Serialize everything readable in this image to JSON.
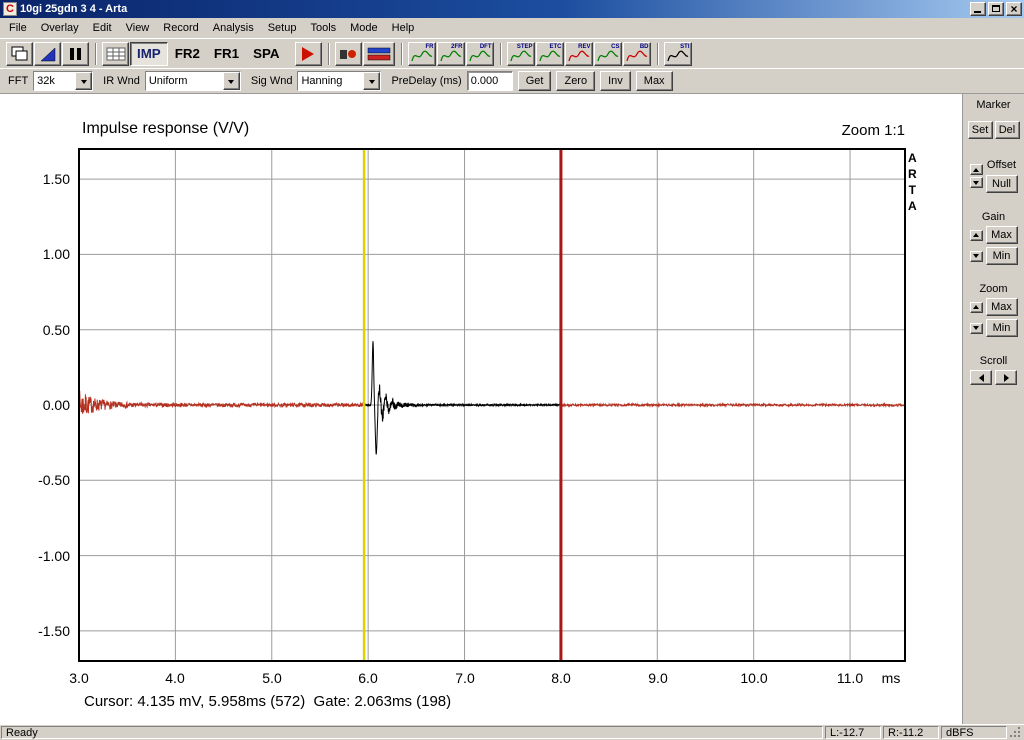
{
  "titlebar": {
    "title": "10gi 25gdn 3 4 - Arta",
    "app_icon_letter": "C"
  },
  "menu": {
    "items": [
      "File",
      "Overlay",
      "Edit",
      "View",
      "Record",
      "Analysis",
      "Setup",
      "Tools",
      "Mode",
      "Help"
    ]
  },
  "toolbar1": {
    "mode_buttons": [
      {
        "label": "IMP",
        "active": true
      },
      {
        "label": "FR2",
        "active": false
      },
      {
        "label": "FR1",
        "active": false
      },
      {
        "label": "SPA",
        "active": false
      }
    ],
    "analysis_icons": [
      {
        "id": "fr",
        "label": "FR",
        "color": "#008000",
        "sep_before": false
      },
      {
        "id": "fr2",
        "label": "2FR",
        "color": "#008000",
        "sep_before": false
      },
      {
        "id": "dft",
        "label": "DFT",
        "color": "#008000",
        "sep_before": false
      },
      {
        "id": "step",
        "label": "STEP",
        "color": "#008000",
        "sep_before": true
      },
      {
        "id": "etc",
        "label": "ETC",
        "color": "#008000",
        "sep_before": false
      },
      {
        "id": "rev",
        "label": "REV",
        "color": "#cc0000",
        "sep_before": false
      },
      {
        "id": "cs",
        "label": "CS",
        "color": "#008000",
        "sep_before": false
      },
      {
        "id": "bd",
        "label": "BD",
        "color": "#cc0000",
        "sep_before": false
      },
      {
        "id": "sti",
        "label": "STI",
        "color": "#000000",
        "sep_before": true
      }
    ]
  },
  "controlbar": {
    "fft_label": "FFT",
    "fft_value": "32k",
    "ir_wnd_label": "IR Wnd",
    "ir_wnd_value": "Uniform",
    "sig_wnd_label": "Sig Wnd",
    "sig_wnd_value": "Hanning",
    "predelay_label": "PreDelay (ms)",
    "predelay_value": "0.000",
    "get_label": "Get",
    "zero_label": "Zero",
    "inv_label": "Inv",
    "max_label": "Max"
  },
  "side_panel": {
    "marker_label": "Marker",
    "set_label": "Set",
    "del_label": "Del",
    "offset_label": "Offset",
    "null_label": "Null",
    "gain_label": "Gain",
    "gain_max_label": "Max",
    "gain_min_label": "Min",
    "zoom_label": "Zoom",
    "zoom_max_label": "Max",
    "zoom_min_label": "Min",
    "scroll_label": "Scroll"
  },
  "chart": {
    "title": "Impulse response (V/V)",
    "zoom_indicator": "Zoom 1:1",
    "watermark": "ARTA",
    "y_ticks": [
      "1.50",
      "1.00",
      "0.50",
      "0.00",
      "-0.50",
      "-1.00",
      "-1.50"
    ],
    "x_ticks": [
      "3.0",
      "4.0",
      "5.0",
      "6.0",
      "7.0",
      "8.0",
      "9.0",
      "10.0",
      "11.0"
    ],
    "x_unit": "ms",
    "cursor_readout": "Cursor: 4.135 mV, 5.958ms (572)  Gate: 2.063ms (198)"
  },
  "chart_data": {
    "type": "line",
    "title": "Impulse response (V/V)",
    "xlabel": "ms",
    "ylabel": "V/V",
    "x_range": [
      3.0,
      11.57
    ],
    "y_range": [
      -1.7,
      1.7
    ],
    "x_gridstep": 1.0,
    "y_gridstep": 0.5,
    "cursor_ms": 5.958,
    "cursor_value_mV": 4.135,
    "cursor_sample": 572,
    "gate_ms": 8.0,
    "gate_length_ms": 2.063,
    "gate_sample": 198,
    "peak_ms": 6.05,
    "peak_value": 0.42,
    "trough_value": -0.33,
    "noise_amp": 0.012,
    "burst_amp": 0.09,
    "pre_color": "#b5301f",
    "impulse_color": "#000000",
    "post_color": "#b5301f",
    "cursor_color": "#d8d400",
    "gate_color": "#aa1515",
    "grid_color": "#9c9c9c"
  },
  "statusbar": {
    "ready": "Ready",
    "left_level": "L:-12.7",
    "right_level": "R:-11.2",
    "unit": "dBFS"
  }
}
